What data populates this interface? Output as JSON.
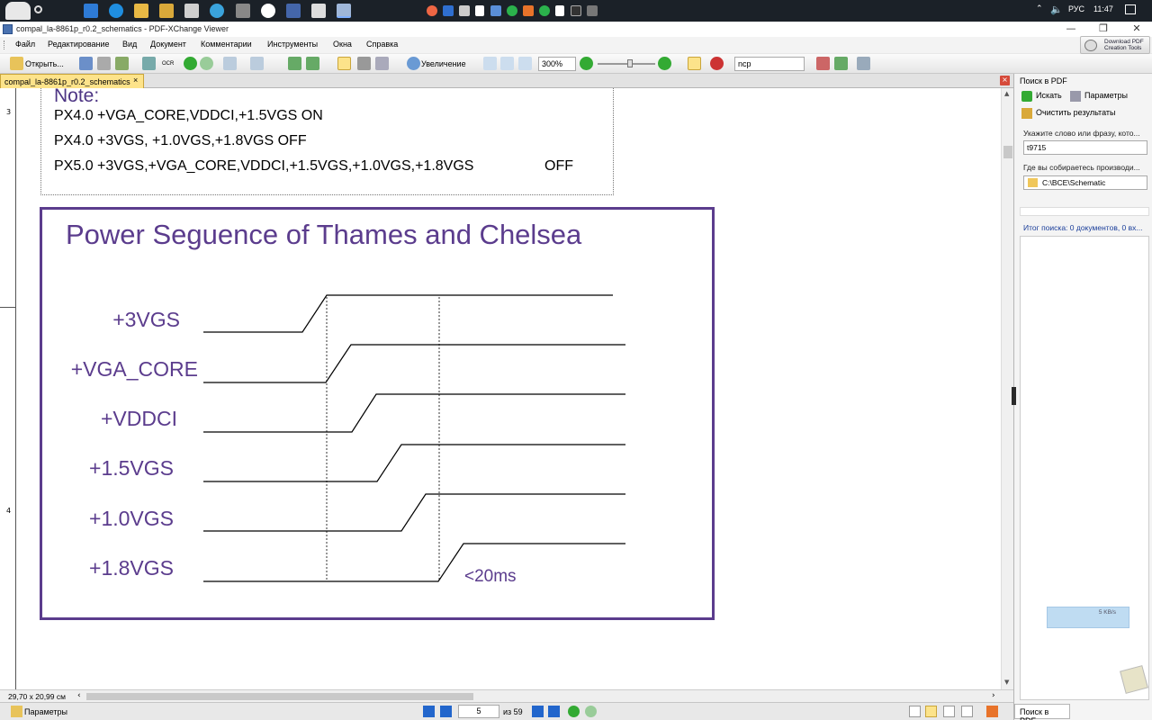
{
  "window": {
    "title": "compal_la-8861p_r0.2_schematics - PDF-XChange Viewer",
    "minimize": "—",
    "maximize": "❐",
    "close": "✕"
  },
  "tray": {
    "language": "РУС",
    "time": "11:47"
  },
  "menu": [
    "Файл",
    "Редактирование",
    "Вид",
    "Документ",
    "Комментарии",
    "Инструменты",
    "Окна",
    "Справка"
  ],
  "download_pdf": {
    "line1": "Download PDF",
    "line2": "Creation Tools"
  },
  "toolbar": {
    "open_label": "Открыть...",
    "zoom_label": "Увеличение",
    "zoom_value": "300%",
    "search_text": "ncp",
    "ocr_label": "OCR"
  },
  "tab": {
    "label": "compal_la-8861p_r0.2_schematics",
    "close": "×"
  },
  "ruler": {
    "marks": [
      "3",
      "4"
    ]
  },
  "page": {
    "note_title": "Note:",
    "note_lines": [
      "PX4.0 +VGA_CORE,VDDCI,+1.5VGS ON",
      "PX4.0 +3VGS, +1.0VGS,+1.8VGS OFF",
      "PX5.0 +3VGS,+VGA_CORE,VDDCI,+1.5VGS,+1.0VGS,+1.8VGS"
    ],
    "note_off": "OFF",
    "diagram_title": "Power Seguence of Thames and Chelsea",
    "rails": [
      "+3VGS",
      "+VGA_CORE",
      "+VDDCI",
      "+1.5VGS",
      "+1.0VGS",
      "+1.8VGS"
    ],
    "timing_note": "<20ms",
    "accent_color": "#5b3c8d"
  },
  "status": {
    "page_size": "29,70 x 20,99 см",
    "settings_label": "Параметры",
    "current_page": "5",
    "page_total": "из 59"
  },
  "panel": {
    "title": "Поиск в PDF",
    "search_button": "Искать",
    "options_button": "Параметры",
    "clear_button": "Очистить результаты",
    "query_label": "Укажите слово или фразу, кото...",
    "query_value": "t9715",
    "location_label": "Где вы собираетесь производи...",
    "location_value": "C:\\BCE\\Schematic",
    "result_text": "Итог поиска: 0 документов, 0 вх...",
    "network_speed": "5 KB/s",
    "bottom_tab": "Поиск в PDF"
  },
  "icons": [
    "app-icon",
    "folder-icon",
    "save-icon",
    "print-icon",
    "hand-icon",
    "zoom-icon",
    "first-page-icon",
    "prev-page-icon",
    "next-page-icon",
    "last-page-icon",
    "back-icon",
    "forward-icon",
    "volume-icon",
    "notification-icon"
  ]
}
